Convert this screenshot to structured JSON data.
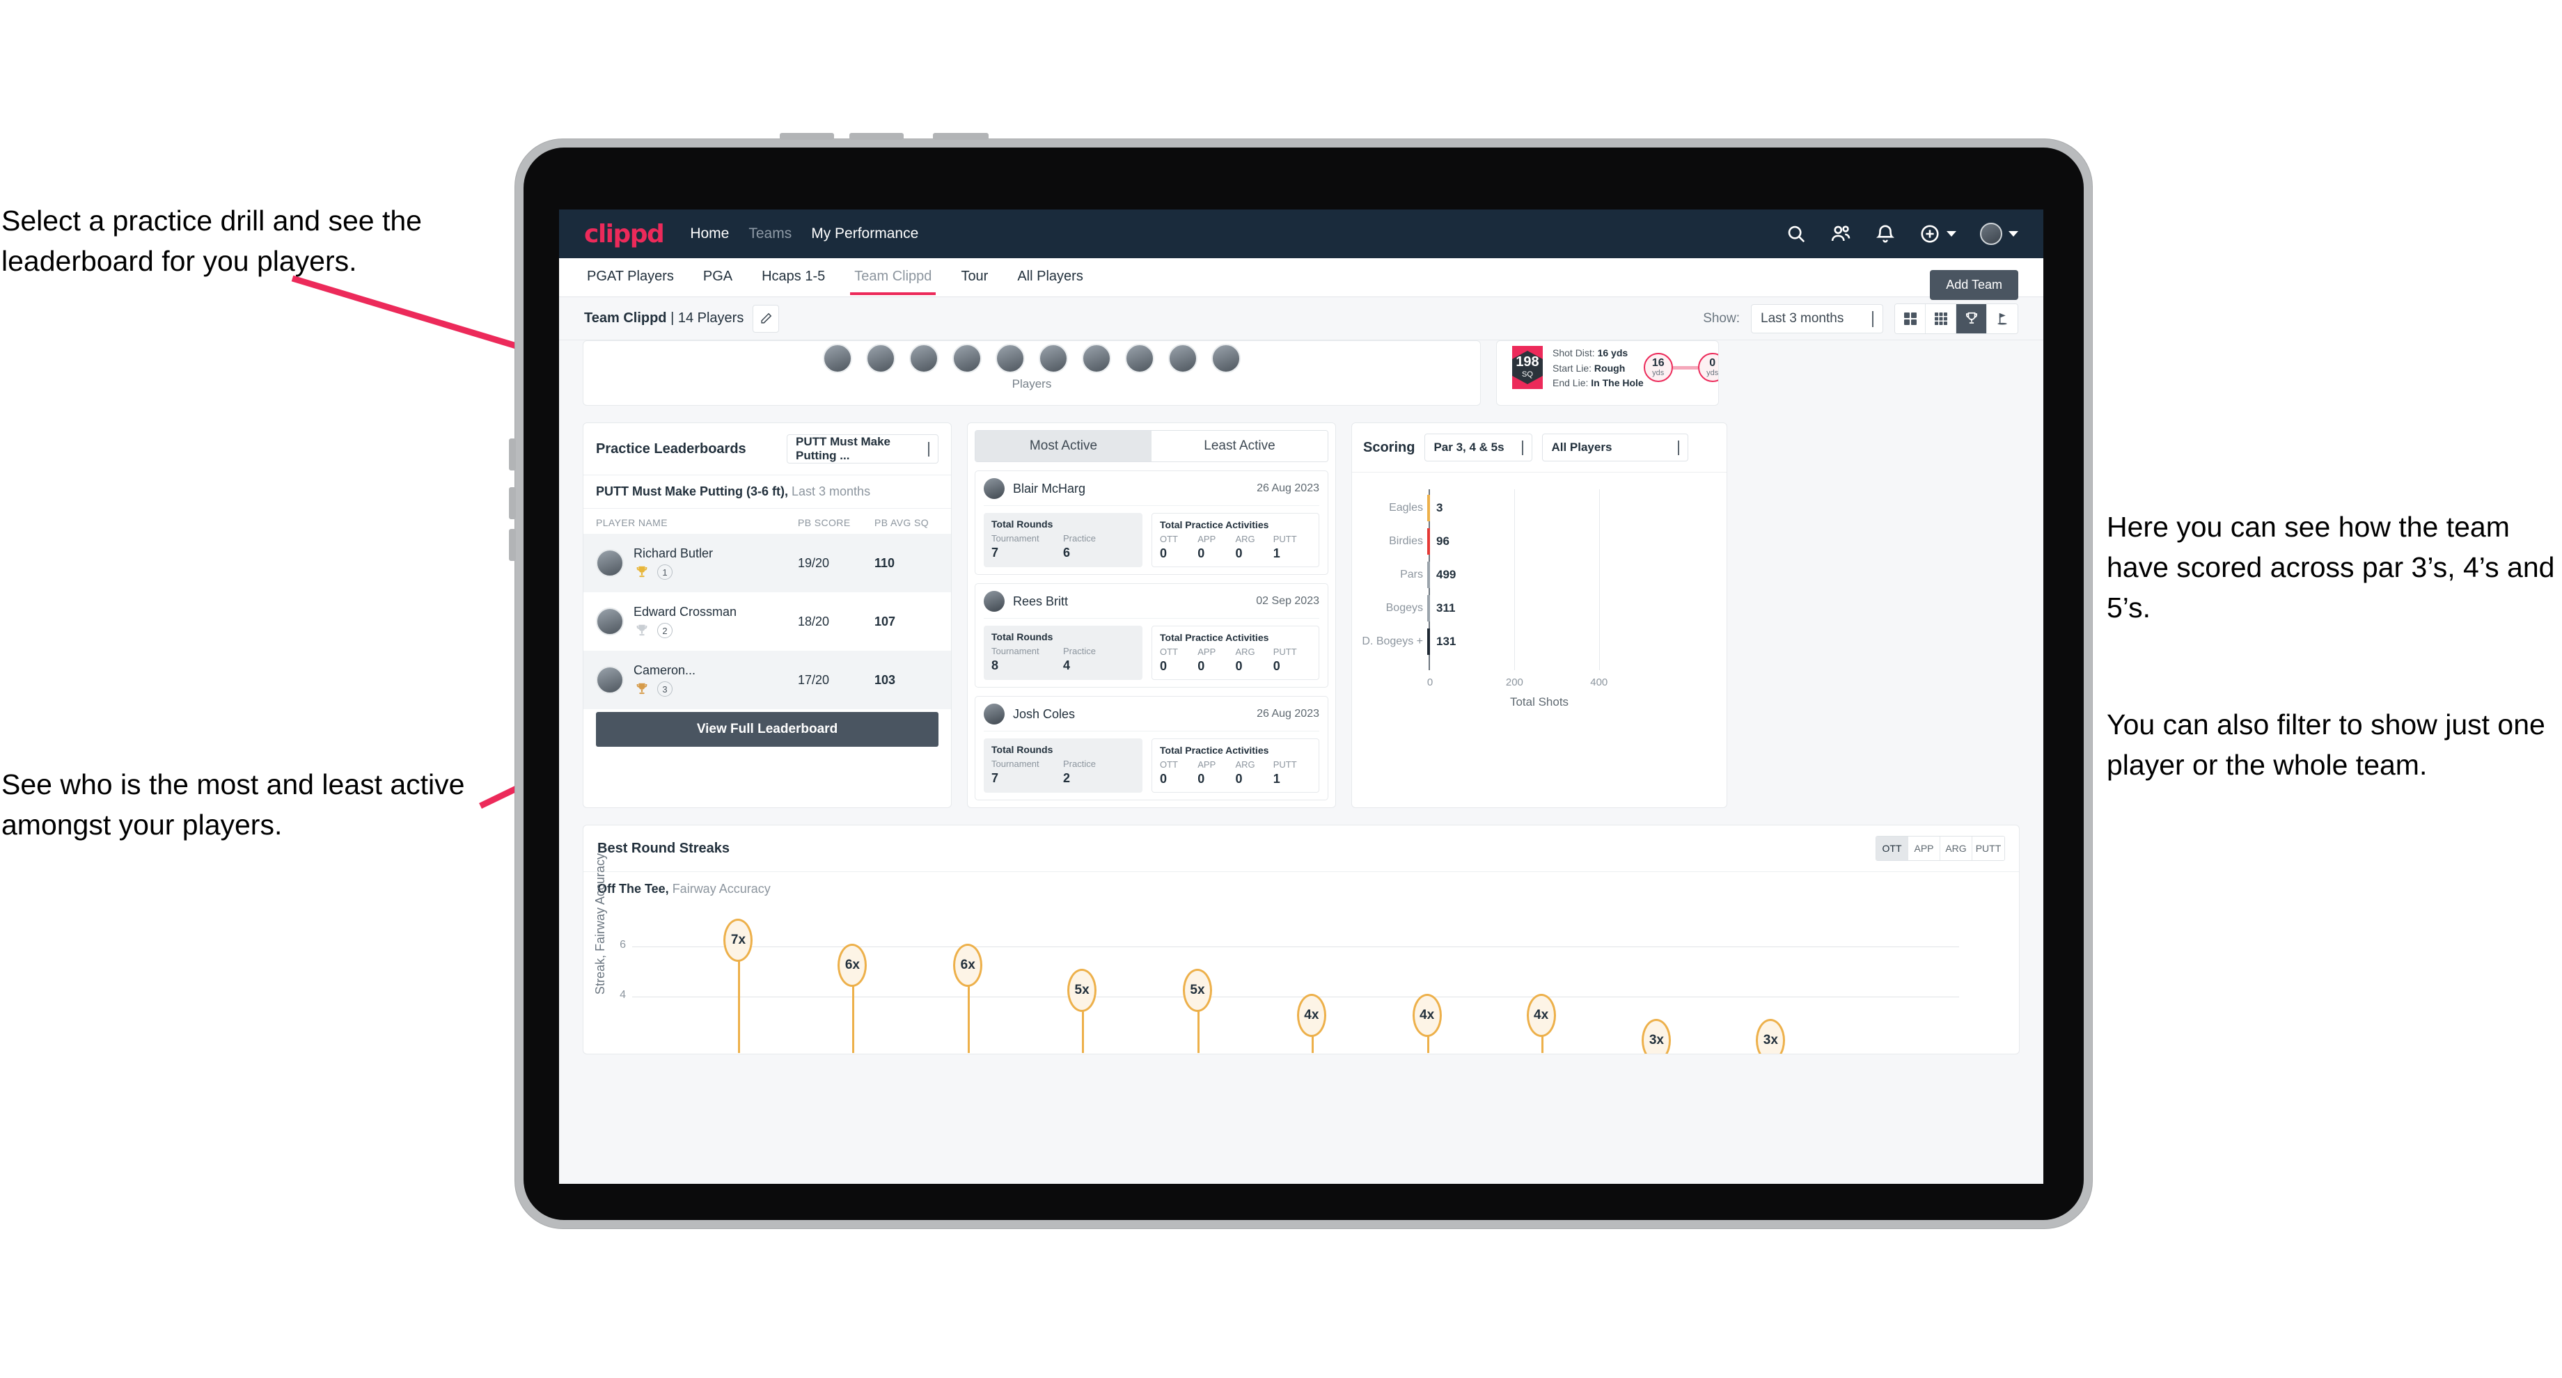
{
  "annotations": {
    "top_left": "Select a practice drill and see the leaderboard for you players.",
    "mid_left": "See who is the most and least active amongst your players.",
    "right_1": "Here you can see how the team have scored across par 3’s, 4’s and 5’s.",
    "right_2": "You can also filter to show just one player or the whole team."
  },
  "colors": {
    "brand_pink": "#ec2a5a",
    "nav_dark": "#1a2b3c",
    "slate": "#4a5561",
    "amber": "#edb04a"
  },
  "navbar": {
    "logo": "clippd",
    "links": [
      {
        "label": "Home",
        "active": true
      },
      {
        "label": "Teams",
        "active": false
      },
      {
        "label": "My Performance",
        "active": true
      }
    ],
    "icons": [
      "search-icon",
      "people-icon",
      "bell-icon",
      "plus-circle-icon",
      "avatar"
    ]
  },
  "subtabs": {
    "items": [
      "PGAT Players",
      "PGA",
      "Hcaps 1-5",
      "Team Clippd",
      "Tour",
      "All Players"
    ],
    "active": "Team Clippd",
    "add_team_label": "Add Team"
  },
  "toolbar": {
    "team_name": "Team Clippd",
    "player_count": "14 Players",
    "separator": " | ",
    "show_label": "Show:",
    "show_value": "Last 3 months",
    "view_modes": [
      "grid-2x2-icon",
      "grid-3x3-icon",
      "trophy-icon",
      "golf-flag-icon"
    ],
    "active_view": "trophy-icon"
  },
  "players_card": {
    "caption": "Players",
    "avatar_count": 10
  },
  "shot_card": {
    "sq_value": "198",
    "sq_unit": "SQ",
    "lines": [
      {
        "label": "Shot Dist:",
        "value": "16 yds"
      },
      {
        "label": "Start Lie:",
        "value": "Rough"
      },
      {
        "label": "End Lie:",
        "value": "In The Hole"
      }
    ],
    "start_dist": "16",
    "start_unit": "yds",
    "end_dist": "0",
    "end_unit": "yds"
  },
  "leaderboard": {
    "title": "Practice Leaderboards",
    "drill_select": "PUTT Must Make Putting ...",
    "subtitle_bold": "PUTT Must Make Putting (3-6 ft),",
    "subtitle_rest": " Last 3 months",
    "columns": [
      "PLAYER NAME",
      "PB SCORE",
      "PB AVG SQ"
    ],
    "rows": [
      {
        "name": "Richard Butler",
        "rank": "1",
        "trophy": "gold",
        "pb_score": "19/20",
        "pb_avg_sq": "110"
      },
      {
        "name": "Edward Crossman",
        "rank": "2",
        "trophy": "silver",
        "pb_score": "18/20",
        "pb_avg_sq": "107"
      },
      {
        "name": "Cameron...",
        "rank": "3",
        "trophy": "bronze",
        "pb_score": "17/20",
        "pb_avg_sq": "103"
      }
    ],
    "button_label": "View Full Leaderboard"
  },
  "activity": {
    "tabs": [
      "Most Active",
      "Least Active"
    ],
    "active_tab": "Most Active",
    "rounds_heading": "Total Rounds",
    "rounds_labels": [
      "Tournament",
      "Practice"
    ],
    "activities_heading": "Total Practice Activities",
    "activities_labels": [
      "OTT",
      "APP",
      "ARG",
      "PUTT"
    ],
    "items": [
      {
        "name": "Blair McHarg",
        "date": "26 Aug 2023",
        "rounds": [
          "7",
          "6"
        ],
        "activities": [
          "0",
          "0",
          "0",
          "1"
        ]
      },
      {
        "name": "Rees Britt",
        "date": "02 Sep 2023",
        "rounds": [
          "8",
          "4"
        ],
        "activities": [
          "0",
          "0",
          "0",
          "0"
        ]
      },
      {
        "name": "Josh Coles",
        "date": "26 Aug 2023",
        "rounds": [
          "7",
          "2"
        ],
        "activities": [
          "0",
          "0",
          "0",
          "1"
        ]
      }
    ]
  },
  "scoring": {
    "title": "Scoring",
    "par_filter": "Par 3, 4 & 5s",
    "player_filter": "All Players"
  },
  "streaks": {
    "title": "Best Round Streaks",
    "tabs": [
      "OTT",
      "APP",
      "ARG",
      "PUTT"
    ],
    "active_tab": "OTT",
    "subtitle_bold": "Off The Tee,",
    "subtitle_rest": " Fairway Accuracy",
    "y_axis_label": "Streak, Fairway Accuracy"
  },
  "chart_data": [
    {
      "type": "bar",
      "orientation": "horizontal",
      "title": "Scoring",
      "categories": [
        "Eagles",
        "Birdies",
        "Pars",
        "Bogeys",
        "D. Bogeys +"
      ],
      "values": [
        3,
        96,
        499,
        311,
        131
      ],
      "cap_colors": [
        "#edb04a",
        "#e53935",
        "#9aa3ab",
        "#9aa3ab",
        "#1e2833"
      ],
      "xlabel": "Total Shots",
      "ylabel": "",
      "xlim": [
        0,
        560
      ],
      "xticks": [
        0,
        200,
        400
      ],
      "grid": true,
      "legend": "none"
    },
    {
      "type": "scatter",
      "title": "Best Round Streaks",
      "subtitle": "Off The Tee, Fairway Accuracy",
      "xlabel": "",
      "ylabel": "Streak, Fairway Accuracy",
      "ylim": [
        0,
        8
      ],
      "yticks": [
        4,
        6
      ],
      "labels": [
        "7x",
        "6x",
        "6x",
        "5x",
        "5x",
        "4x",
        "4x",
        "4x",
        "3x",
        "3x"
      ],
      "values": [
        7,
        6,
        6,
        5,
        5,
        4,
        4,
        4,
        3,
        3
      ],
      "grid": true,
      "marker": "lollipop-pill"
    }
  ]
}
